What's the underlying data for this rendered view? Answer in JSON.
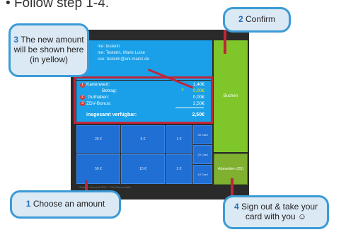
{
  "heading": "Follow step 1-4.",
  "terminal": {
    "info": [
      {
        "prefix": "me:",
        "value": "testerin"
      },
      {
        "prefix": "me:",
        "value": "Testerin, Marie Luise"
      },
      {
        "prefix": "sse:",
        "value": "testerin@uni-mainz.de"
      }
    ],
    "balance": [
      {
        "marker": "1",
        "label": "Kartenwert:",
        "value": "1,40€"
      },
      {
        "marker": "",
        "label": "Betrag:",
        "value": "0,00€",
        "highlight": "yellow"
      },
      {
        "marker": "2",
        "label": "Guthaben:",
        "value": "0,00€"
      },
      {
        "marker": "3",
        "label": "ZDV-Bonus:",
        "value": "2,50€"
      }
    ],
    "total_label": "insgesamt verfügbar:",
    "total_value": "2,50€",
    "buchen_label": "Buchen",
    "abmelden_label": "Abmelden (25)",
    "amounts_row1": [
      "20 €",
      "5 €",
      "1 €"
    ],
    "amounts_row2": [
      "50 €",
      "10 €",
      "2 €"
    ],
    "card_buttons": [
      "30 Card",
      "20 Card",
      "10 Card"
    ],
    "footer": "Station: Terminal ZDV – ZDV-Bonus aktiv"
  },
  "bubbles": {
    "b1": {
      "num": "1",
      "text": "Choose an amount"
    },
    "b2": {
      "num": "2",
      "text": "Confirm"
    },
    "b3": {
      "num": "3",
      "text": "The new amount will be shown here (in yellow)"
    },
    "b4": {
      "num": "4",
      "text": "Sign out & take your card with you ☺"
    }
  },
  "colors": {
    "terminal_blue": "#1aa0e8",
    "confirm_green": "#7fc62a",
    "highlight_red": "#c0263a",
    "bubble_border": "#3b9bd6",
    "amount_yellow": "#f2e600"
  }
}
